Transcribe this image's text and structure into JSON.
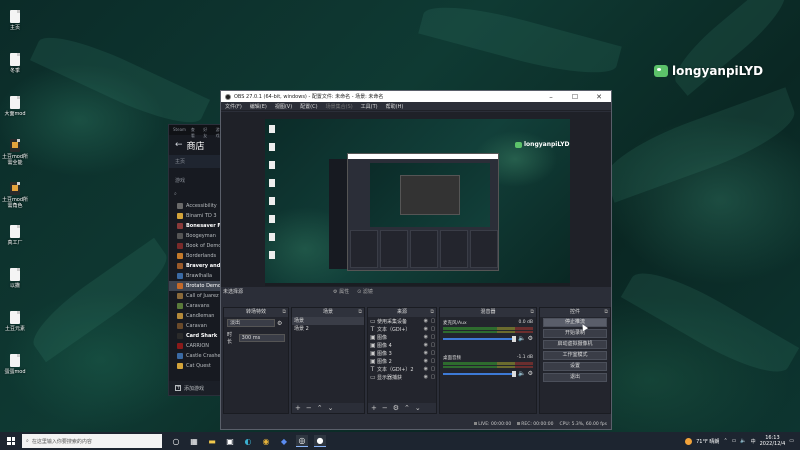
{
  "desktop": {
    "icons": [
      {
        "label": "主页",
        "dark": false
      },
      {
        "label": "冬季",
        "dark": false
      },
      {
        "label": "大面mod",
        "dark": false
      },
      {
        "label": "土豆mod所\n需全能",
        "dark": true
      },
      {
        "label": "土豆mod所\n需角色",
        "dark": true
      },
      {
        "label": "真工厂",
        "dark": false
      },
      {
        "label": "以撒",
        "dark": false
      },
      {
        "label": "土豆元素",
        "dark": false
      },
      {
        "label": "蛋蛋mod",
        "dark": false
      }
    ],
    "watermark": "longyanpiLYD"
  },
  "steam": {
    "menu": [
      "Steam",
      "查看",
      "好友",
      "游戏"
    ],
    "store_title": "商店",
    "home": "主页",
    "section": "游戏",
    "games": [
      {
        "name": "Accessibility",
        "color": "#6a6a6a",
        "style": "normal"
      },
      {
        "name": "Binami TD 3",
        "color": "#d4a43a",
        "style": "normal"
      },
      {
        "name": "Bonesaver Finiss",
        "color": "#8a3a3a",
        "style": "bold"
      },
      {
        "name": "Boogeyman",
        "color": "#555",
        "style": "normal"
      },
      {
        "name": "Book of Demons",
        "color": "#7a2a2a",
        "style": "normal"
      },
      {
        "name": "Borderlands",
        "color": "#c47a2a",
        "style": "normal"
      },
      {
        "name": "Bravery and Greed",
        "color": "#9a5a2a",
        "style": "bold"
      },
      {
        "name": "Brawlhalla",
        "color": "#3a6aa4",
        "style": "normal"
      },
      {
        "name": "Brotato Demo",
        "color": "#c46a2a",
        "style": "selected"
      },
      {
        "name": "Call of Juarez",
        "color": "#8a6a3a",
        "style": "normal"
      },
      {
        "name": "Caravans",
        "color": "#5a7a3a",
        "style": "normal"
      },
      {
        "name": "Candleman",
        "color": "#b48a3a",
        "style": "normal"
      },
      {
        "name": "Caravan",
        "color": "#6a4a2a",
        "style": "normal"
      },
      {
        "name": "Card Shark",
        "color": "#2a2a2a",
        "style": "bold"
      },
      {
        "name": "CARRION",
        "color": "#8a1a1a",
        "style": "normal"
      },
      {
        "name": "Castle Crashers",
        "color": "#3a6aa4",
        "style": "normal"
      },
      {
        "name": "Cat Quest",
        "color": "#d4a43a",
        "style": "normal"
      }
    ],
    "add_game": "添加游戏"
  },
  "obs": {
    "title": "OBS 27.0.1 (64-bit, windows) - 配置文件: 未命名 - 场景: 未命名",
    "menu": [
      "文件(F)",
      "编辑(E)",
      "视图(V)",
      "配置(C)",
      "场景集合(S)",
      "工具(T)",
      "帮助(H)"
    ],
    "no_source": "未选择源",
    "properties": "属性",
    "filters": "滤镜",
    "docks": {
      "transitions": {
        "title": "转场特效",
        "type": "淡出",
        "duration_label": "时长",
        "duration": "300 ms"
      },
      "scenes": {
        "title": "场景",
        "items": [
          "场景",
          "场景 2"
        ]
      },
      "sources": {
        "title": "来源",
        "items": [
          {
            "icon": "display-icon",
            "glyph": "▭",
            "name": "使用采集设备"
          },
          {
            "icon": "text-icon",
            "glyph": "T",
            "name": "文本（GDI+）"
          },
          {
            "icon": "image-icon",
            "glyph": "▣",
            "name": "图像"
          },
          {
            "icon": "image-icon",
            "glyph": "▣",
            "name": "图像 4"
          },
          {
            "icon": "image-icon",
            "glyph": "▣",
            "name": "图像 3"
          },
          {
            "icon": "image-icon",
            "glyph": "▣",
            "name": "图像 2"
          },
          {
            "icon": "text-icon",
            "glyph": "T",
            "name": "文本（GDI+）2"
          },
          {
            "icon": "monitor-icon",
            "glyph": "▭",
            "name": "显示器捕获"
          }
        ]
      },
      "mixer": {
        "title": "混音器",
        "channels": [
          {
            "name": "麦克风/Aux",
            "db": "0.0 dB"
          },
          {
            "name": "桌面音频",
            "db": "-1.1 dB"
          }
        ]
      },
      "controls": {
        "title": "控件",
        "buttons": [
          "停止推流",
          "开始录制",
          "启动虚拟摄像机",
          "工作室模式",
          "设置",
          "退出"
        ]
      }
    },
    "status": {
      "live": "LIVE: 00:00:00",
      "rec": "REC: 00:00:00",
      "cpu": "CPU: 5.3%, 60.00 fps"
    }
  },
  "taskbar": {
    "search_placeholder": "在这里输入你要搜索的内容",
    "weather": "71°F 晴朗",
    "time": "16:13",
    "date": "2022/12/4"
  }
}
